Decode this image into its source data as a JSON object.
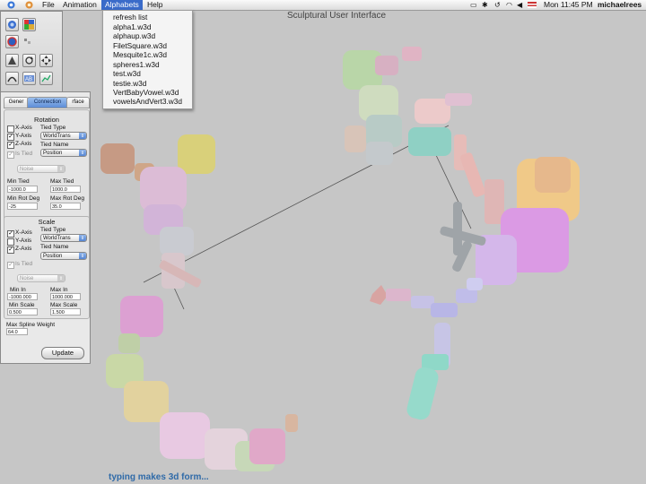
{
  "menubar": {
    "items": [
      "File",
      "Animation",
      "Alphabets",
      "Help"
    ],
    "active": "Alphabets",
    "clock": "Mon 11:45 PM",
    "user": "michaelrees"
  },
  "alphabets_menu": {
    "items": [
      "refresh list",
      "alpha1.w3d",
      "alphaup.w3d",
      "FiletSquare.w3d",
      "Mesquite1c.w3d",
      "spheres1.w3d",
      "test.w3d",
      "testie.w3d",
      "VertBabyVowel.w3d",
      "vowelsAndVert3.w3d"
    ]
  },
  "window_title": "Sculptural User Interface",
  "tabs": [
    "Gener",
    "Connection",
    "rface"
  ],
  "rotation": {
    "title": "Rotation",
    "x_axis": {
      "label": "X-Axis",
      "checked": false
    },
    "y_axis": {
      "label": "Y-Axis",
      "checked": true
    },
    "z_axis": {
      "label": "Z-Axis",
      "checked": true
    },
    "tied_type_label": "Tied Type",
    "tied_type_value": "WorldTrans",
    "tied_name_label": "Tied Name",
    "tied_name_value": "Position",
    "is_tied": {
      "label": "Is Tied",
      "checked": true
    },
    "noise_value": "Noise",
    "min_tied_label": "Min Tied",
    "min_tied_value": "-1000.0",
    "max_tied_label": "Max Tied",
    "max_tied_value": "1000.0",
    "min_rot_label": "Min Rot Deg",
    "min_rot_value": "-25",
    "max_rot_label": "Max Rot Deg",
    "max_rot_value": "35.0"
  },
  "scale": {
    "title": "Scale",
    "x_axis": {
      "label": "X-Axis",
      "checked": true
    },
    "y_axis": {
      "label": "Y-Axis",
      "checked": false
    },
    "z_axis": {
      "label": "Z-Axis",
      "checked": true
    },
    "tied_type_label": "Tied Type",
    "tied_type_value": "WorldTrans",
    "tied_name_label": "Tied Name",
    "tied_name_value": "Position",
    "is_tied": {
      "label": "Is Tied",
      "checked": true
    },
    "noise_value": "Noise",
    "min_in_label": "Min In",
    "min_in_value": "-1000.000",
    "max_in_label": "Max In",
    "max_in_value": "1000.000",
    "min_scale_label": "Min Scale",
    "min_scale_value": "0.500",
    "max_scale_label": "Max Scale",
    "max_scale_value": "1.500"
  },
  "max_spline_label": "Max Spline Weight",
  "max_spline_value": "64.0",
  "update_label": "Update",
  "status_text": "typing makes 3d form...",
  "colors": {
    "menu_highlight": "#3a6bc9",
    "status_text": "#2f6aa8",
    "background": "#c6c6c6",
    "tab_active": "#6b97dc"
  }
}
